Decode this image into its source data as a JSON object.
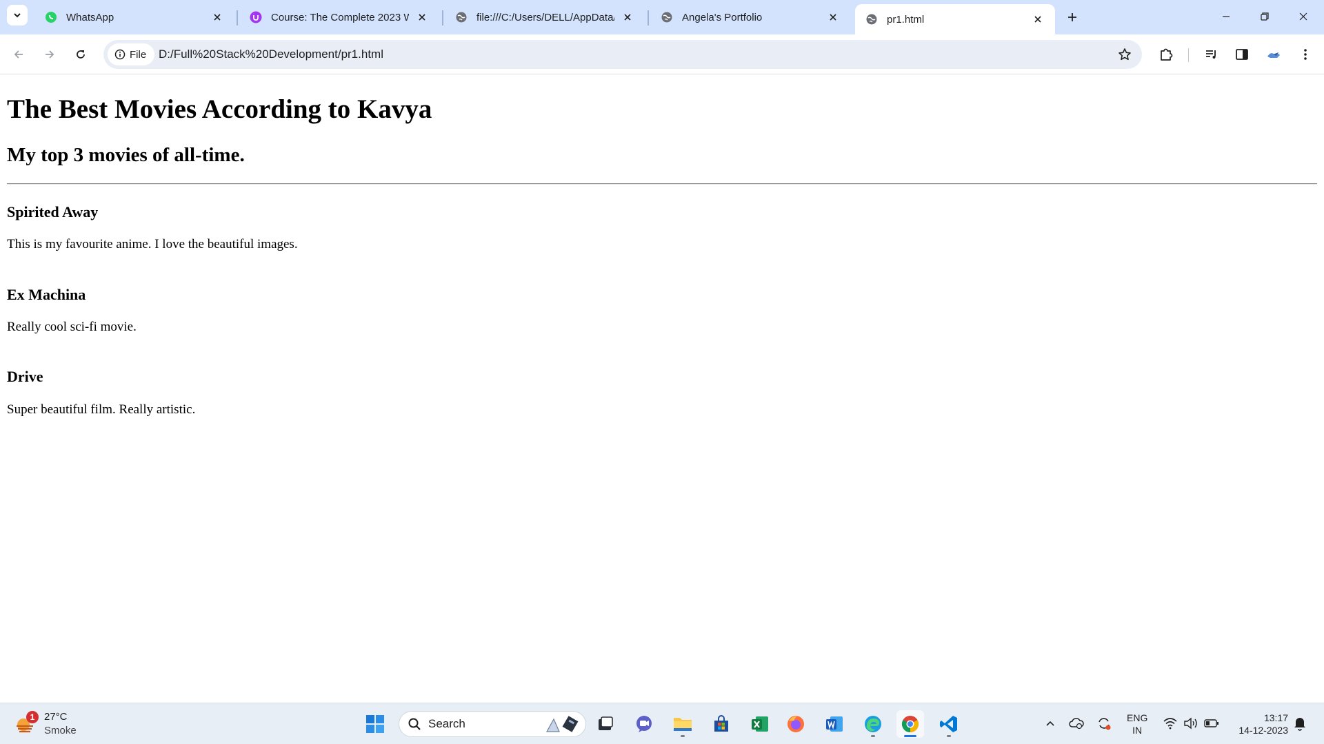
{
  "browser": {
    "tabs": [
      {
        "title": "WhatsApp",
        "favicon": "whatsapp-icon",
        "active": false
      },
      {
        "title": "Course: The Complete 2023 We",
        "favicon": "udemy-icon",
        "active": false
      },
      {
        "title": "file:///C:/Users/DELL/AppData/L",
        "favicon": "globe-icon",
        "active": false
      },
      {
        "title": "Angela's Portfolio",
        "favicon": "globe-icon",
        "active": false
      },
      {
        "title": "pr1.html",
        "favicon": "globe-icon",
        "active": true
      }
    ],
    "omnibox": {
      "chip_label": "File",
      "url": "D:/Full%20Stack%20Development/pr1.html"
    }
  },
  "page": {
    "heading": "The Best Movies According to Kavya",
    "subheading": "My top 3 movies of all-time.",
    "movies": [
      {
        "title": "Spirited Away",
        "description": "This is my favourite anime. I love the beautiful images."
      },
      {
        "title": "Ex Machina",
        "description": "Really cool sci-fi movie."
      },
      {
        "title": "Drive",
        "description": "Super beautiful film. Really artistic."
      }
    ]
  },
  "taskbar": {
    "weather": {
      "temperature": "27°C",
      "condition": "Smoke",
      "badge": "1"
    },
    "search_label": "Search",
    "language": {
      "line1": "ENG",
      "line2": "IN"
    },
    "clock": {
      "time": "13:17",
      "date": "14-12-2023"
    }
  },
  "colors": {
    "tabstrip": "#d3e3fd",
    "omnibox": "#e9eef6",
    "taskbar": "#e8eef6",
    "accent": "#1a73e8"
  }
}
